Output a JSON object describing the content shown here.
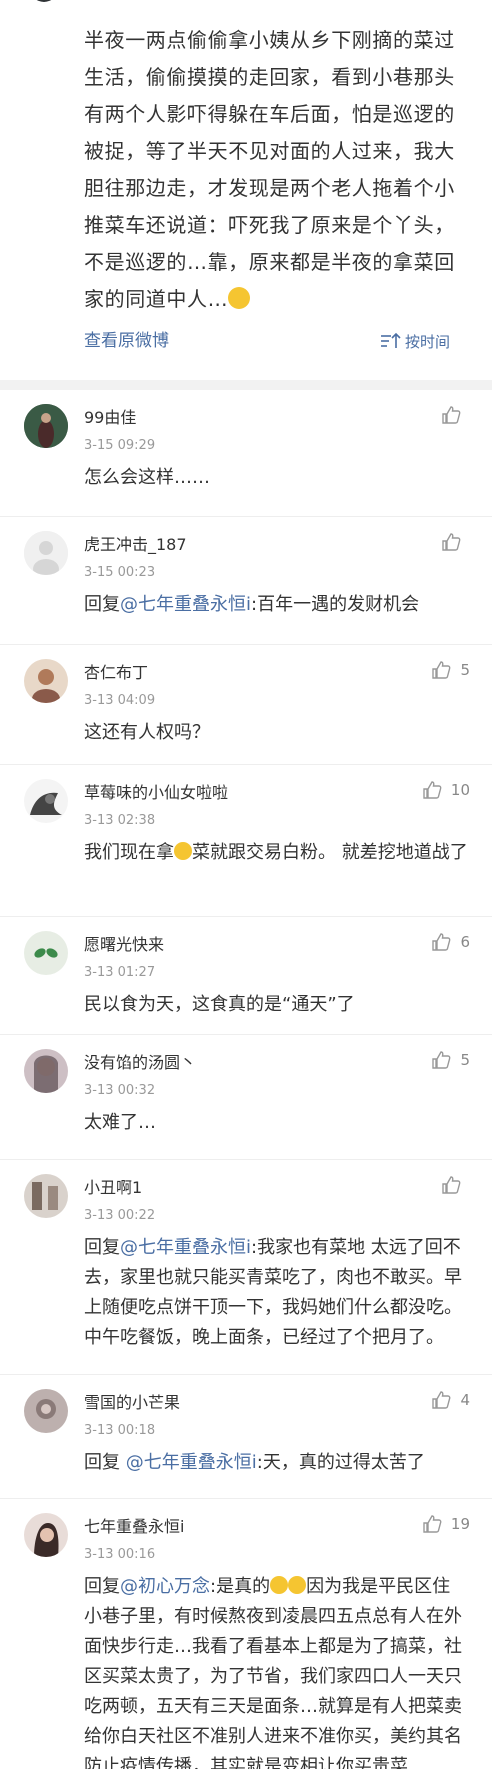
{
  "post": {
    "text": "半夜一两点偷偷拿小姨从乡下刚摘的菜过生活，偷偷摸摸的走回家，看到小巷那头有两个人影吓得躲在车后面，怕是巡逻的被捉，等了半天不见对面的人过来，我大胆往那边走，才发现是两个老人拖着个小推菜车还说道：吓死我了原来是个丫头，不是巡逻的…靠，原来都是半夜的拿菜回家的同道中人…",
    "view_original": "查看原微博",
    "sort_label": "按时间"
  },
  "comments": [
    {
      "name": "99由佳",
      "time": "3-15 09:29",
      "text": "怎么会这样……",
      "likes": "",
      "avatar_color": "#3a5a45"
    },
    {
      "name": "虎王冲击_187",
      "time": "3-15 00:23",
      "reply_prefix": "回复",
      "mention": "@七年重叠永恒i",
      "text": ":百年一遇的发财机会",
      "likes": "",
      "avatar_color": "#e6e6e6"
    },
    {
      "name": "杏仁布丁",
      "time": "3-13 04:09",
      "text": "这还有人权吗？",
      "likes": "5",
      "avatar_color": "#8a5a4a"
    },
    {
      "name": "草莓味的小仙女啦啦",
      "time": "3-13 02:38",
      "text": "我们现在拿",
      "text2": "菜就跟交易白粉。 就差挖地道战了",
      "likes": "10",
      "avatar_color": "#555555"
    },
    {
      "name": "愿曙光快来",
      "time": "3-13 01:27",
      "text": "民以食为天，这食真的是“通天”了",
      "likes": "6",
      "avatar_color": "#dfe7dc"
    },
    {
      "name": "没有馅的汤圆丶",
      "time": "3-13 00:32",
      "text": "太难了…",
      "likes": "5",
      "avatar_color": "#7a6a70"
    },
    {
      "name": "小丑啊1",
      "time": "3-13 00:22",
      "reply_prefix": "回复",
      "mention": "@七年重叠永恒i",
      "text": ":我家也有菜地 太远了回不去，家里也就只能买青菜吃了，肉也不敢买。早上随便吃点饼干顶一下，我妈她们什么都没吃。中午吃餐饭，晚上面条，已经过了个把月了。",
      "likes": "",
      "avatar_color": "#9a8a80"
    },
    {
      "name": "雪国的小芒果",
      "time": "3-13 00:18",
      "reply_prefix": "回复 ",
      "mention": "@七年重叠永恒i",
      "text": ":天，真的过得太苦了",
      "likes": "4",
      "avatar_color": "#8a7a78"
    },
    {
      "name": "七年重叠永恒i",
      "time": "3-13 00:16",
      "reply_prefix": "回复",
      "mention": "@初心万念",
      "text": ":是真的",
      "text2": "因为我是平民区住小巷子里，有时候熬夜到凌晨四五点总有人在外面快步行走…我看了看基本上都是为了搞菜，社区买菜太贵了，为了节省，我们家四口人一天只吃两顿，五天有三天是面条…就算是有人把菜卖给你白天社区不准别人进来不准你买，美约其名防止疫情传播，其实就是变相让你买贵菜",
      "likes": "19",
      "avatar_color": "#5a4a48"
    }
  ]
}
